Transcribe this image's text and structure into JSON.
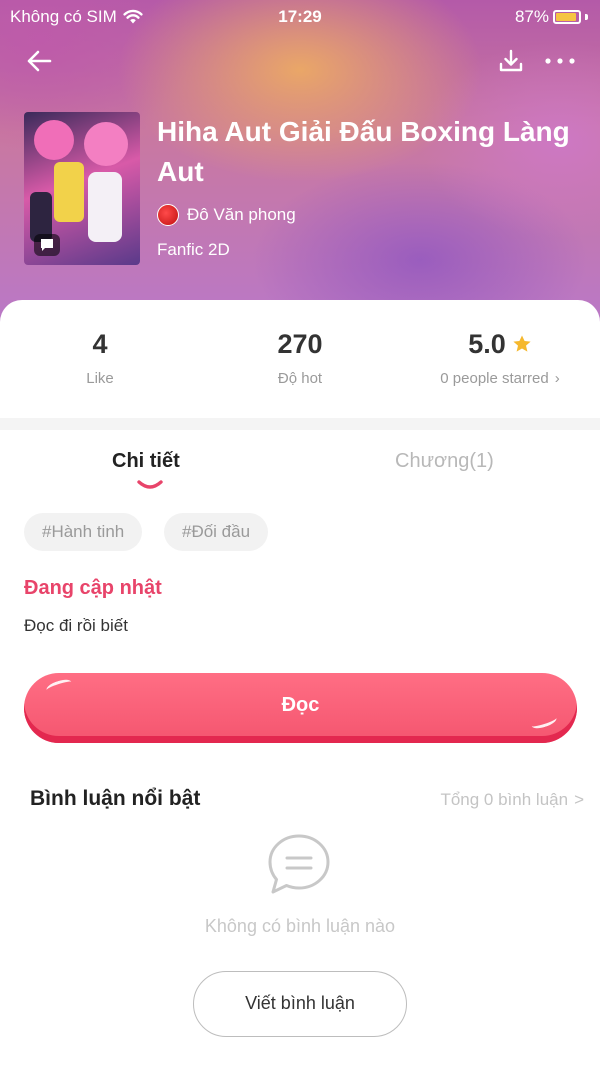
{
  "status_bar": {
    "carrier": "Không có SIM",
    "time": "17:29",
    "battery": "87%"
  },
  "icons": {
    "back": "arrow-left-icon",
    "download": "download-icon",
    "more": "more-dots-icon",
    "star": "star-icon",
    "comment": "comment-bubble-icon"
  },
  "colors": {
    "accent": "#e8446a",
    "button": "#f4556f",
    "star": "#f5b82e"
  },
  "book": {
    "title": "Hiha Aut Giải Đấu Boxing Làng Aut",
    "author": "Đô Văn phong",
    "genre": "Fanfic 2D"
  },
  "stats": {
    "like": {
      "value": "4",
      "label": "Like"
    },
    "hot": {
      "value": "270",
      "label": "Độ hot"
    },
    "rating": {
      "value": "5.0",
      "label": "0 people starred",
      "chevron": "›"
    }
  },
  "tabs": {
    "detail": "Chi tiết",
    "chapters": "Chương(1)"
  },
  "tags": [
    "#Hành tinh",
    "#Đối đầu"
  ],
  "detail": {
    "status": "Đang cập nhật",
    "description": "Đọc đi rồi biết"
  },
  "read_button": "Đọc",
  "comments": {
    "title": "Bình luận nổi bật",
    "total": "Tổng 0 bình luận",
    "total_chevron": ">",
    "empty": "Không có bình luận nào",
    "write_button": "Viết bình luận"
  }
}
